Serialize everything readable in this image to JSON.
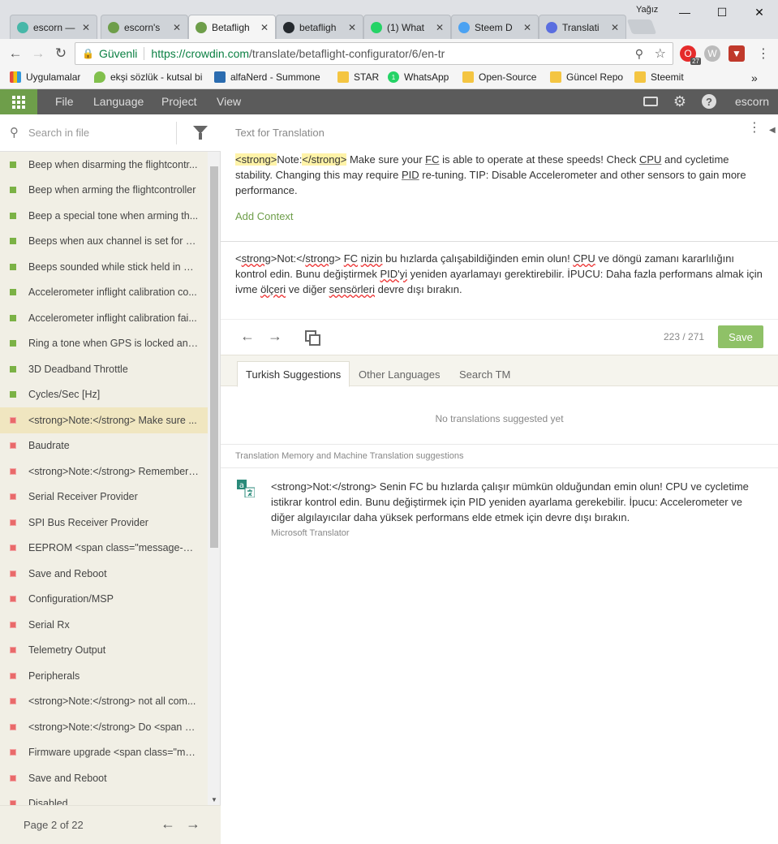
{
  "browser": {
    "user": "Yağız",
    "tabs": [
      {
        "title": "escorn —",
        "color": "#47b7a8",
        "active": false
      },
      {
        "title": "escorn's",
        "color": "#6e9e4a",
        "active": false
      },
      {
        "title": "Betafligh",
        "color": "#6e9e4a",
        "active": true
      },
      {
        "title": "betafligh",
        "color": "#24292e",
        "active": false
      },
      {
        "title": "(1) What",
        "color": "#25d366",
        "active": false
      },
      {
        "title": "Steem D",
        "color": "#4ba2f2",
        "active": false
      },
      {
        "title": "Translati",
        "color": "#5a6ee0",
        "active": false
      }
    ],
    "secure_label": "Güvenli",
    "url_host": "https://crowdin.com",
    "url_path": "/translate/betaflight-configurator/6/en-tr",
    "ext_badge": "27",
    "bookmarks": [
      {
        "label": "Uygulamalar",
        "icon": "apps-icon"
      },
      {
        "label": "ekşi sözlük - kutsal bi",
        "icon": "eksi-icon"
      },
      {
        "label": "alfaNerd - Summone",
        "icon": "alfanerd-icon"
      },
      {
        "label": "STAR",
        "icon": "folder-icon"
      },
      {
        "label": "WhatsApp",
        "icon": "whatsapp-icon"
      },
      {
        "label": "Open-Source",
        "icon": "folder-icon"
      },
      {
        "label": "Güncel Repo",
        "icon": "folder-icon"
      },
      {
        "label": "Steemit",
        "icon": "folder-icon"
      }
    ],
    "more_bookmarks": "»"
  },
  "header": {
    "menu": [
      "File",
      "Language",
      "Project",
      "View"
    ],
    "username": "escorn"
  },
  "sidebar": {
    "search_placeholder": "Search in file",
    "items": [
      {
        "text": "Beep when disarming the flightcontr...",
        "status": "translated",
        "active": false
      },
      {
        "text": "Beep when arming the flightcontroller",
        "status": "translated",
        "active": false
      },
      {
        "text": "Beep a special tone when arming th...",
        "status": "translated",
        "active": false
      },
      {
        "text": "Beeps when aux channel is set for b...",
        "status": "translated",
        "active": false
      },
      {
        "text": "Beeps sounded while stick held in di...",
        "status": "translated",
        "active": false
      },
      {
        "text": "Accelerometer inflight calibration co...",
        "status": "translated",
        "active": false
      },
      {
        "text": "Accelerometer inflight calibration fai...",
        "status": "translated",
        "active": false
      },
      {
        "text": "Ring a tone when GPS is locked and ...",
        "status": "translated",
        "active": false
      },
      {
        "text": "3D Deadband Throttle",
        "status": "translated",
        "active": false
      },
      {
        "text": "Cycles/Sec [Hz]",
        "status": "translated",
        "active": false
      },
      {
        "text": "<strong>Note:</strong> Make sure ...",
        "status": "untranslated",
        "active": true
      },
      {
        "text": "Baudrate",
        "status": "untranslated",
        "active": false
      },
      {
        "text": "<strong>Note:</strong> Remember ...",
        "status": "untranslated",
        "active": false
      },
      {
        "text": "Serial Receiver Provider",
        "status": "untranslated",
        "active": false
      },
      {
        "text": "SPI Bus Receiver Provider",
        "status": "untranslated",
        "active": false
      },
      {
        "text": "EEPROM <span class=\"message-posi...",
        "status": "untranslated",
        "active": false
      },
      {
        "text": "Save and Reboot",
        "status": "untranslated",
        "active": false
      },
      {
        "text": "Configuration/MSP",
        "status": "untranslated",
        "active": false
      },
      {
        "text": "Serial Rx",
        "status": "untranslated",
        "active": false
      },
      {
        "text": "Telemetry Output",
        "status": "untranslated",
        "active": false
      },
      {
        "text": "Peripherals",
        "status": "untranslated",
        "active": false
      },
      {
        "text": "<strong>Note:</strong> not all com...",
        "status": "untranslated",
        "active": false
      },
      {
        "text": "<strong>Note:</strong> Do <span cl...",
        "status": "untranslated",
        "active": false
      },
      {
        "text": "Firmware upgrade <span class=\"me...",
        "status": "untranslated",
        "active": false
      },
      {
        "text": "Save and Reboot",
        "status": "untranslated",
        "active": false
      },
      {
        "text": "Disabled",
        "status": "untranslated",
        "active": false
      }
    ],
    "pager_label": "Page 2 of 22"
  },
  "source": {
    "heading": "Text for Translation",
    "tag_open": "<strong>",
    "tag_word": "Note:",
    "tag_close": "</strong>",
    "part1": " Make sure your ",
    "fc": "FC",
    "part2": " is able to operate at these speeds! Check ",
    "cpu": "CPU",
    "part3": " and cycletime stability. Changing this may require ",
    "pid": "PID",
    "part4": " re-tuning. TIP: Disable Accelerometer and other sensors to gain more performance.",
    "add_context": "Add Context"
  },
  "translation": {
    "t1": "<",
    "t2": "strong",
    "t3": ">Not:</",
    "t4": "strong",
    "t5": "> ",
    "fc": "FC",
    "t6": " ",
    "nizin": "nizin",
    "t7": " bu hızlarda çalışabildiğinden emin olun! ",
    "cpu": "CPU",
    "t8": " ve döngü zamanı kararlılığını kontrol edin. Bunu değiştirmek ",
    "pid": "PID'yi",
    "t9": " yeniden ayarlamayı gerektirebilir. İPUCU: Daha fazla performans almak için ivme ",
    "olceri": "ölçeri",
    "t10": "  ve diğer ",
    "sensorleri": "sensörleri",
    "t11": " devre dışı bırakın.",
    "counter": "223 / 271",
    "save_label": "Save"
  },
  "suggestions": {
    "tabs": [
      "Turkish Suggestions",
      "Other Languages",
      "Search TM"
    ],
    "none_text": "No translations suggested yet",
    "tm_heading": "Translation Memory and Machine Translation suggestions",
    "mt_text": "<strong>Not:</strong> Senin FC bu hızlarda çalışır mümkün olduğundan emin olun! CPU ve cycletime istikrar kontrol edin. Bunu değiştirmek için PID yeniden ayarlama gerekebilir. İpucu: Accelerometer ve diğer algılayıcılar daha yüksek performans elde etmek için devre dışı bırakın.",
    "mt_source": "Microsoft Translator"
  }
}
